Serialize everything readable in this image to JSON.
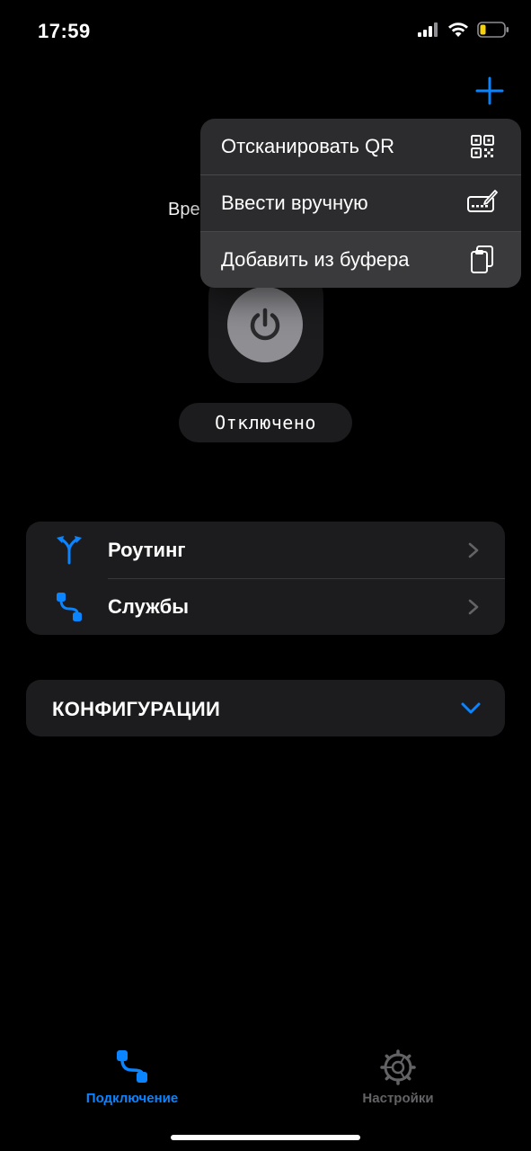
{
  "status_bar": {
    "time": "17:59",
    "icons": [
      "cellular-signal-icon",
      "wifi-icon",
      "battery-icon"
    ],
    "battery_color": "#f5d20a"
  },
  "header": {
    "add_icon": "plus-icon"
  },
  "main": {
    "partial_label": "Вре",
    "power_icon": "power-icon",
    "status": "Отключено"
  },
  "menu": {
    "items": [
      {
        "label": "Отсканировать QR",
        "icon": "qr-code-icon"
      },
      {
        "label": "Ввести вручную",
        "icon": "keyboard-pencil-icon"
      },
      {
        "label": "Добавить из буфера",
        "icon": "clipboard-icon"
      }
    ]
  },
  "list": {
    "items": [
      {
        "label": "Роутинг",
        "icon": "routing-icon"
      },
      {
        "label": "Службы",
        "icon": "services-icon"
      }
    ]
  },
  "config": {
    "title": "КОНФИГУРАЦИИ",
    "icon": "chevron-down-icon"
  },
  "tabbar": {
    "tabs": [
      {
        "label": "Подключение",
        "icon": "connection-icon",
        "active": true
      },
      {
        "label": "Настройки",
        "icon": "gear-icon",
        "active": false
      }
    ]
  },
  "colors": {
    "accent": "#0a84ff",
    "background": "#000000",
    "card": "#1c1c1e",
    "menu": "#2c2c2e",
    "inactive": "#636366"
  }
}
